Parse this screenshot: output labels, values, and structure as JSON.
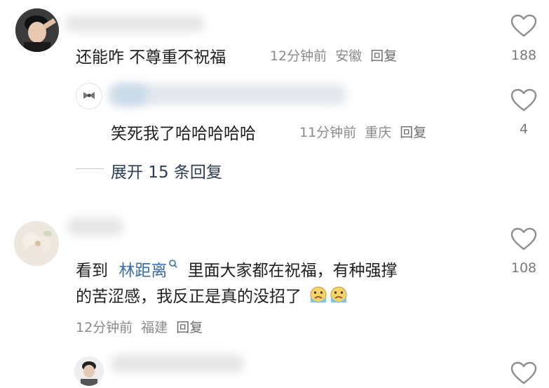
{
  "comments": [
    {
      "text": "还能咋 不尊重不祝福",
      "time": "12分钟前",
      "location": "安徽",
      "reply_label": "回复",
      "likes": "188",
      "avatar_icon": "person-saluting-avatar"
    },
    {
      "text_before": "看到",
      "mention": "林距离",
      "mention_icon": "search-icon",
      "text_after": "里面大家都在祝福，有种强撑",
      "text_line2": "的苦涩感，我反正是真的没招了",
      "emoji_icon": "crying-face-emoji",
      "time": "12分钟前",
      "location": "福建",
      "reply_label": "回复",
      "likes": "108",
      "avatar_icon": "flower-avatar"
    }
  ],
  "reply": {
    "text": "笑死我了哈哈哈哈哈",
    "time": "11分钟前",
    "location": "重庆",
    "reply_label": "回复",
    "likes": "4",
    "avatar_icon": "bow-tie-avatar"
  },
  "expand_replies": {
    "label": "展开 15 条回复"
  },
  "colors": {
    "mention": "#3a6ea5",
    "meta": "#8a8a8a",
    "expand": "#2d3d57"
  }
}
